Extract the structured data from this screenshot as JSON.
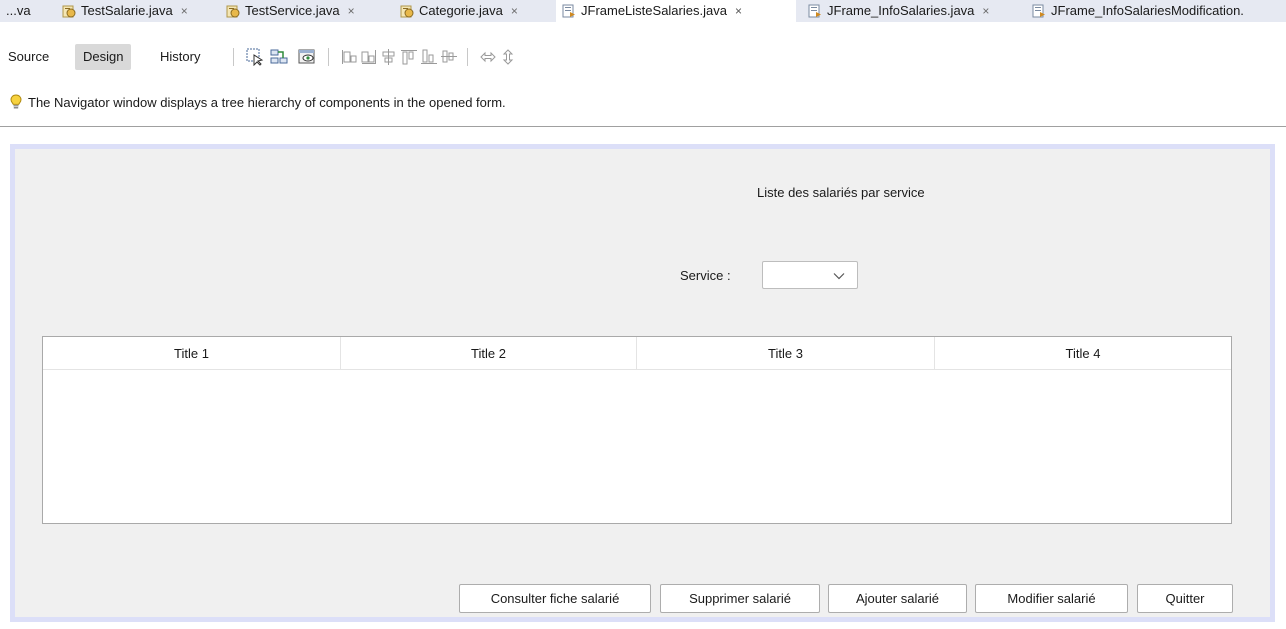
{
  "tabs": [
    {
      "label": "...va",
      "icon": "java-file-icon",
      "active": false,
      "closable": false
    },
    {
      "label": "TestSalarie.java",
      "icon": "java-class-icon",
      "active": false,
      "closable": true
    },
    {
      "label": "TestService.java",
      "icon": "java-class-icon",
      "active": false,
      "closable": true
    },
    {
      "label": "Categorie.java",
      "icon": "java-class-icon",
      "active": false,
      "closable": true
    },
    {
      "label": "JFrameListeSalaries.java",
      "icon": "form-file-icon",
      "active": true,
      "closable": true
    },
    {
      "label": "JFrame_InfoSalaries.java",
      "icon": "form-file-icon",
      "active": false,
      "closable": true
    },
    {
      "label": "JFrame_InfoSalariesModification.",
      "icon": "form-file-icon",
      "active": false,
      "closable": false
    }
  ],
  "close_glyph": "×",
  "toolbar": {
    "source_label": "Source",
    "design_label": "Design",
    "history_label": "History"
  },
  "info": {
    "text": "The Navigator window displays a tree hierarchy of components in the opened form.",
    "icon": "lightbulb-icon"
  },
  "form": {
    "title": "Liste des salariés par service",
    "service_label": "Service :",
    "service_value": "",
    "table": {
      "columns": [
        "Title 1",
        "Title 2",
        "Title 3",
        "Title 4"
      ],
      "rows": []
    },
    "buttons": {
      "consult": "Consulter fiche salarié",
      "delete": "Supprimer salarié",
      "add": "Ajouter salarié",
      "modify": "Modifier salarié",
      "quit": "Quitter"
    }
  },
  "colors": {
    "tabbar_bg": "#e6e9f2",
    "form_bg": "#f0f0f0",
    "form_border": "#dcdff8",
    "design_active_bg": "#d9d9d9"
  }
}
